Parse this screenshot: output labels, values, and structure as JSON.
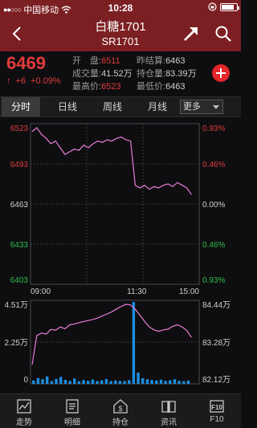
{
  "status": {
    "carrier": "中国移动",
    "time": "10:28",
    "battery_level": 0.85
  },
  "header": {
    "title": "白糖1701",
    "subtitle": "SR1701"
  },
  "quote": {
    "price": "6469",
    "change": "+6",
    "change_pct": "+0.09%",
    "open_label": "开　盘:",
    "open": "6511",
    "prev_settle_label": "昨结算:",
    "prev_settle": "6463",
    "volume_label": "成交量:",
    "volume": "41.52万",
    "open_interest_label": "持仓量:",
    "open_interest": "83.39万",
    "high_label": "最高价:",
    "high": "6523",
    "low_label": "最低价:",
    "low": "6463"
  },
  "tabs": [
    "分时",
    "日线",
    "周线",
    "月线"
  ],
  "tabs_more": "更多",
  "chart_data": [
    {
      "type": "line",
      "x_labels": [
        "09:00",
        "11:30",
        "15:00"
      ],
      "left_ticks": [
        "6523",
        "6493",
        "6463",
        "6433",
        "6403"
      ],
      "right_ticks": [
        "0.93%",
        "0.46%",
        "0.00%",
        "0.46%",
        "0.93%"
      ],
      "ylim": [
        6403,
        6523
      ],
      "series": [
        {
          "values": [
            6517,
            6520,
            6515,
            6512,
            6508,
            6510,
            6505,
            6500,
            6502,
            6504,
            6503,
            6507,
            6505,
            6508,
            6510,
            6509,
            6511,
            6510,
            6512,
            6513,
            6511,
            6510,
            6477,
            6475,
            6477,
            6474,
            6476,
            6475,
            6477,
            6478,
            6476,
            6479,
            6477,
            6475,
            6470
          ]
        }
      ]
    },
    {
      "type": "bar",
      "left_ticks": [
        "4.51万",
        "2.25万",
        "0"
      ],
      "right_ticks": [
        "84.44万",
        "83.28万",
        "82.12万"
      ],
      "volume_ylim": [
        0,
        45100
      ],
      "volume": [
        1800,
        3200,
        2500,
        4100,
        1500,
        2700,
        3800,
        2200,
        1600,
        2900,
        1400,
        2100,
        1700,
        2400,
        1500,
        1900,
        2600,
        1500,
        1800,
        1600,
        1500,
        2000,
        45000,
        6200,
        3100,
        2500,
        2100,
        1800,
        2300,
        1700,
        1900,
        2500,
        1600,
        1400,
        1800
      ],
      "oi_ylim": [
        821200,
        844400
      ],
      "open_interest": [
        826500,
        834600,
        835300,
        835000,
        836300,
        836100,
        837000,
        836500,
        837600,
        837800,
        838200,
        838500,
        838800,
        839100,
        839500,
        840100,
        840600,
        841200,
        842000,
        842700,
        843300,
        843100,
        841900,
        840300,
        838500,
        837000,
        836200,
        835800,
        836200,
        836400,
        837200,
        837600,
        837000,
        836000,
        834100
      ]
    }
  ],
  "nav": [
    {
      "label": "走势",
      "icon": "trend-chart-icon"
    },
    {
      "label": "明细",
      "icon": "detail-list-icon"
    },
    {
      "label": "持仓",
      "icon": "position-dollar-icon"
    },
    {
      "label": "资讯",
      "icon": "news-book-icon"
    },
    {
      "label": "F10",
      "icon": "f10-icon"
    }
  ],
  "colors": {
    "header_bg": "#7c1f22",
    "up": "#e23b3b",
    "down": "#2fbf4f",
    "price_line": "#ea7bd6",
    "volume_bar": "#1d8fe0"
  }
}
